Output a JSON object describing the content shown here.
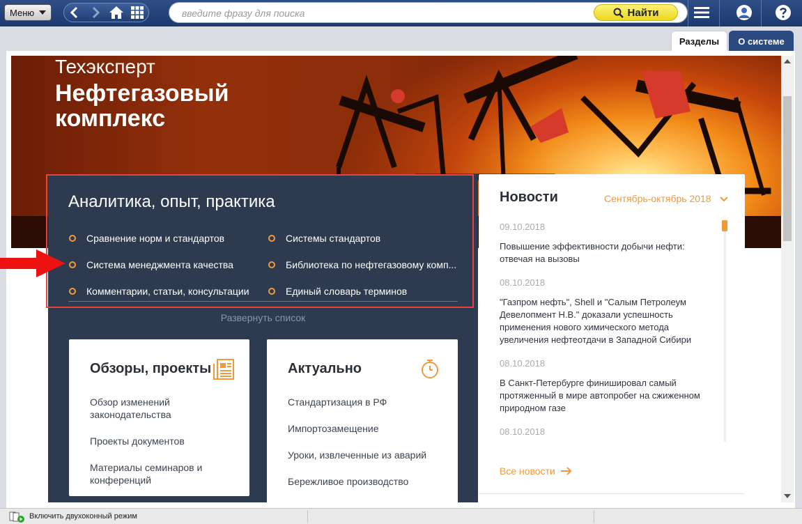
{
  "toolbar": {
    "menu_label": "Меню",
    "search_placeholder": "введите фразу для поиска",
    "find_label": "Найти"
  },
  "tabs": {
    "sections": "Разделы",
    "about": "О системе"
  },
  "hero": {
    "brand": "Техэксперт",
    "title": "Нефтегазовый комплекс"
  },
  "analytics": {
    "title": "Аналитика, опыт, практика",
    "items": [
      "Сравнение норм и стандартов",
      "Системы стандартов",
      "Система менеджмента качества",
      "Библиотека по нефтегазовому комп...",
      "Комментарии, статьи, консультации",
      "Единый словарь терминов"
    ],
    "expand_label": "Развернуть список"
  },
  "reviews": {
    "title": "Обзоры, проекты",
    "links": [
      "Обзор изменений законодательства",
      "Проекты документов",
      "Материалы семинаров и конференций"
    ]
  },
  "actual": {
    "title": "Актуально",
    "links": [
      "Стандартизация в РФ",
      "Импортозамещение",
      "Уроки, извлеченные из аварий",
      "Бережливое производство"
    ]
  },
  "news": {
    "title": "Новости",
    "period": "Сентябрь-октябрь 2018",
    "items": [
      {
        "date": "09.10.2018",
        "text": "Повышение эффективности добычи нефти: отвечая на вызовы"
      },
      {
        "date": "08.10.2018",
        "text": "\"Газпром нефть\", Shell и \"Салым Петролеум Девелопмент Н.В.\" доказали успешность применения нового химического метода увеличения нефтеотдачи в Западной Сибири"
      },
      {
        "date": "08.10.2018",
        "text": "В Санкт-Петербурге финишировал самый протяженный в мире автопробег на сжиженном природном газе"
      },
      {
        "date": "08.10.2018",
        "text": ""
      }
    ],
    "all_label": "Все новости"
  },
  "status": {
    "dual_mode": "Включить двухоконный режим"
  },
  "colors": {
    "accent_orange": "#f0983a",
    "panel_dark": "#2d3a4f",
    "highlight_red": "#e64440",
    "toolbar_blue": "#1c3a6e",
    "find_yellow": "#ecd81d"
  },
  "icons": [
    "menu-dropdown-icon",
    "back-icon",
    "forward-icon",
    "home-icon",
    "grid-icon",
    "search-icon",
    "list-menu-icon",
    "user-icon",
    "help-icon",
    "document-icon",
    "stopwatch-icon",
    "chevron-down-icon",
    "arrow-right-icon",
    "dual-window-icon"
  ]
}
